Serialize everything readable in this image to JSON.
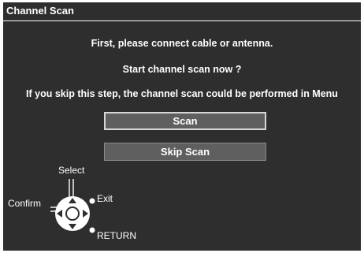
{
  "dialog": {
    "title": "Channel Scan",
    "messages": {
      "line1": "First, please connect cable or antenna.",
      "line2": "Start channel scan now ?",
      "line3": "If you skip this step, the channel scan could be performed in Menu"
    },
    "buttons": {
      "scan": "Scan",
      "skip": "Skip Scan"
    },
    "selected_button": "Scan"
  },
  "guide": {
    "select": "Select",
    "confirm": "Confirm",
    "exit": "Exit",
    "return": "RETURN"
  },
  "colors": {
    "panel_background": "#2e2e2e",
    "button_background": "#5f5f5f",
    "text": "#ffffff"
  }
}
